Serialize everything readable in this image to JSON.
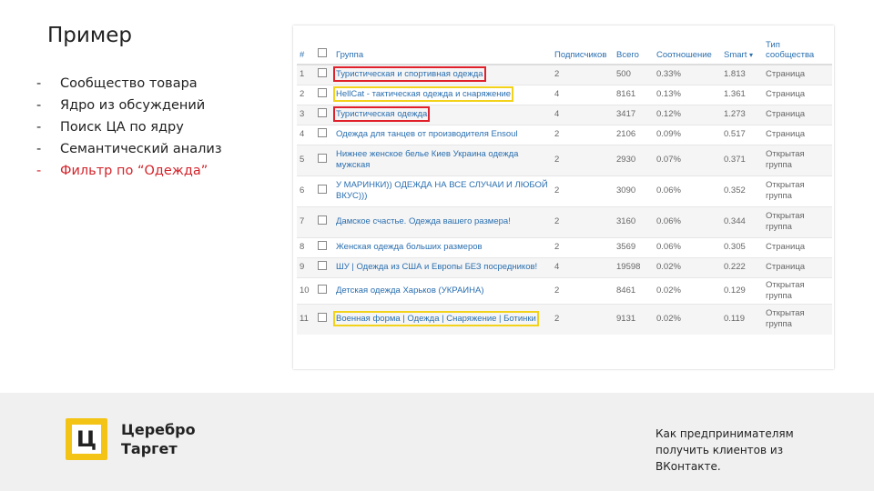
{
  "slide": {
    "title": "Пример",
    "bullets": [
      {
        "dash": "-",
        "text": "Сообщество товара",
        "highlight": false
      },
      {
        "dash": "-",
        "text": "Ядро из обсуждений",
        "highlight": false
      },
      {
        "dash": "-",
        "text": "Поиск ЦА по ядру",
        "highlight": false
      },
      {
        "dash": "-",
        "text": "Семантический анализ",
        "highlight": false
      },
      {
        "dash": "-",
        "text": "Фильтр по “Одежда”",
        "highlight": true
      }
    ],
    "highlight_color": "#d3232a"
  },
  "table": {
    "headers": {
      "num": "#",
      "group": "Группа",
      "subscribers": "Подписчиков",
      "total": "Всего",
      "ratio": "Соотношение",
      "smart": "Smart",
      "smart_sort": "▾",
      "type": "Тип сообщества"
    },
    "rows": [
      {
        "num": "1",
        "group": "Туристическая и спортивная одежда",
        "subs": "2",
        "total": "500",
        "ratio": "0.33%",
        "smart": "1.813",
        "type": "Страница",
        "box": "red"
      },
      {
        "num": "2",
        "group": "HellCat - тактическая одежда и снаряжение",
        "subs": "4",
        "total": "8161",
        "ratio": "0.13%",
        "smart": "1.361",
        "type": "Страница",
        "box": "yellow"
      },
      {
        "num": "3",
        "group": "Туристическая одежда",
        "subs": "4",
        "total": "3417",
        "ratio": "0.12%",
        "smart": "1.273",
        "type": "Страница",
        "box": "red"
      },
      {
        "num": "4",
        "group": "Одежда для танцев от производителя Ensoul",
        "subs": "2",
        "total": "2106",
        "ratio": "0.09%",
        "smart": "0.517",
        "type": "Страница",
        "box": ""
      },
      {
        "num": "5",
        "group": "Нижнее женское белье Киев Украина одежда мужская",
        "subs": "2",
        "total": "2930",
        "ratio": "0.07%",
        "smart": "0.371",
        "type": "Открытая группа",
        "box": ""
      },
      {
        "num": "6",
        "group": "У МАРИНКИ)) ОДЕЖДА НА ВСЕ СЛУЧАИ И ЛЮБОЙ ВКУС)))",
        "subs": "2",
        "total": "3090",
        "ratio": "0.06%",
        "smart": "0.352",
        "type": "Открытая группа",
        "box": ""
      },
      {
        "num": "7",
        "group": "Дамское счастье. Одежда вашего размера!",
        "subs": "2",
        "total": "3160",
        "ratio": "0.06%",
        "smart": "0.344",
        "type": "Открытая группа",
        "box": ""
      },
      {
        "num": "8",
        "group": "Женская одежда больших размеров",
        "subs": "2",
        "total": "3569",
        "ratio": "0.06%",
        "smart": "0.305",
        "type": "Страница",
        "box": ""
      },
      {
        "num": "9",
        "group": "ШУ | Одежда из США и Европы БЕЗ посредников!",
        "subs": "4",
        "total": "19598",
        "ratio": "0.02%",
        "smart": "0.222",
        "type": "Страница",
        "box": ""
      },
      {
        "num": "10",
        "group": "Детская одежда Харьков (УКРАИНА)",
        "subs": "2",
        "total": "8461",
        "ratio": "0.02%",
        "smart": "0.129",
        "type": "Открытая группа",
        "box": ""
      },
      {
        "num": "11",
        "group": "Военная форма | Одежда | Снаряжение | Ботинки",
        "subs": "2",
        "total": "9131",
        "ratio": "0.02%",
        "smart": "0.119",
        "type": "Открытая группа",
        "box": "yellow"
      }
    ],
    "box_colors": {
      "red": "#e0202a",
      "yellow": "#f2d21a"
    }
  },
  "footer": {
    "logo_glyph": "Ц",
    "logo_line1": "Церебро",
    "logo_line2": "Таргет",
    "tagline": "Как предпринимателям получить клиентов из ВКонтакте.",
    "logo_color": "#f3c416"
  }
}
